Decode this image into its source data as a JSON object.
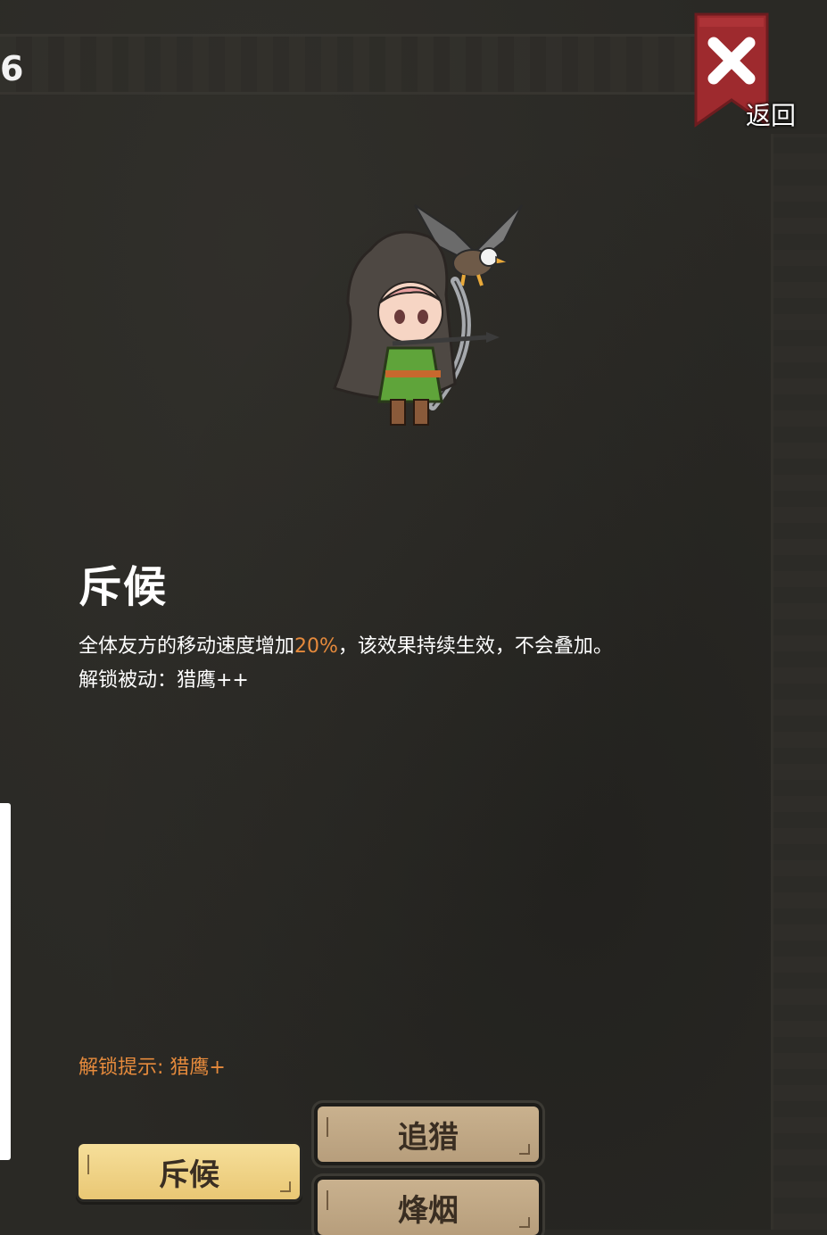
{
  "header": {
    "corner_number": "6",
    "close_label": "返回"
  },
  "skill": {
    "title": "斥候",
    "desc_before": "全体友方的移动速度增加",
    "desc_value": "20%",
    "desc_after": "，该效果持续生效，不会叠加。",
    "passive_line": "解锁被动：猎鹰++",
    "unlock_hint": "解锁提示: 猎鹰+"
  },
  "tabs": [
    {
      "label": "斥候"
    },
    {
      "label": "追猎"
    },
    {
      "label": "烽烟"
    }
  ],
  "colors": {
    "accent": "#e58a3c",
    "ribbon": "#9e2a2e",
    "tab_active": "#f2d686",
    "tab_inactive": "#c2aa86"
  },
  "icons": {
    "close": "close-icon",
    "hero": "archer-with-eagle-portrait"
  }
}
